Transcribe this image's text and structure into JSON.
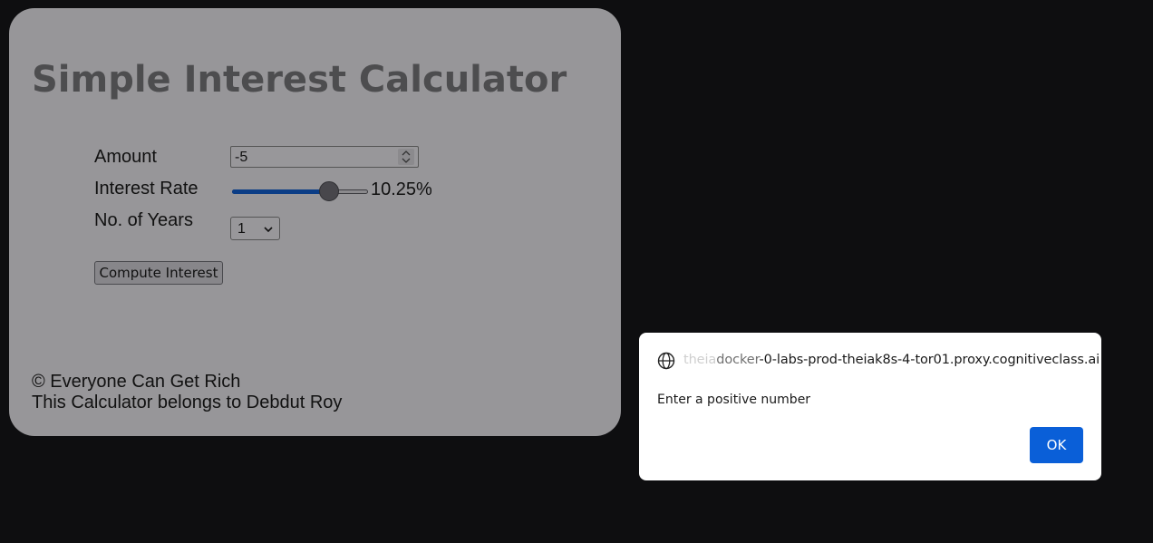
{
  "calculator": {
    "title": "Simple Interest Calculator",
    "amount_label": "Amount",
    "amount_value": "-5",
    "rate_label": "Interest Rate",
    "rate_value_text": "10.25%",
    "rate_slider_fraction": 0.71,
    "years_label": "No. of Years",
    "years_selected": "1",
    "compute_button": "Compute Interest",
    "footer_line1": "© Everyone Can Get Rich",
    "footer_line2": "This Calculator belongs to Debdut Roy"
  },
  "alert": {
    "origin_faded": "theia",
    "origin_semi": "docker",
    "origin_rest": "-0-labs-prod-theiak8s-4-tor01.proxy.cognitiveclass.ai",
    "message": "Enter a positive number",
    "ok_label": "OK",
    "icon": "globe-icon"
  },
  "colors": {
    "page_background": "#0e0e10",
    "card_background": "#979699",
    "title_color": "#4d4d4f",
    "slider_fill": "#0b3d86",
    "ok_button": "#0a5fd8"
  }
}
